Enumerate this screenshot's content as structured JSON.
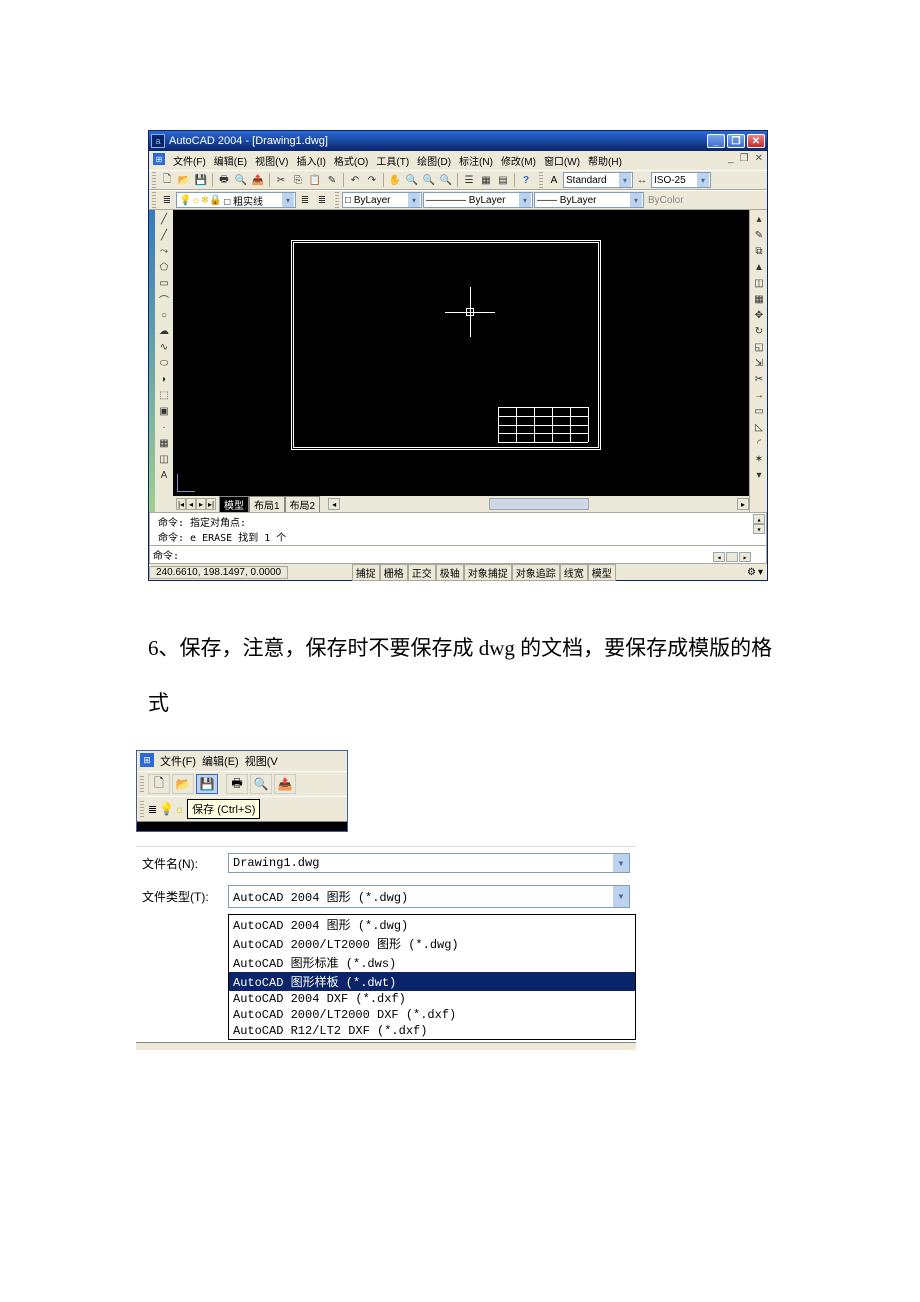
{
  "acad": {
    "title": "AutoCAD 2004 - [Drawing1.dwg]",
    "menu": [
      "文件(F)",
      "编辑(E)",
      "视图(V)",
      "插入(I)",
      "格式(O)",
      "工具(T)",
      "绘图(D)",
      "标注(N)",
      "修改(M)",
      "窗口(W)",
      "帮助(H)"
    ],
    "layerCombo": "□ 粗实线",
    "colorCombo": "□ ByLayer",
    "linetypeCombo": "———— ByLayer",
    "lineweightCombo": "—— ByLayer",
    "bycolorLabel": "ByColor",
    "textStyle": "Standard",
    "dimStyle": "ISO-25",
    "tabs": {
      "model": "模型",
      "layout1": "布局1",
      "layout2": "布局2"
    },
    "cmd": {
      "line1": "命令: 指定对角点:",
      "line2": "命令: e ERASE 找到 1 个",
      "prompt": "命令:"
    },
    "status": {
      "coords": "240.6610, 198.1497, 0.0000",
      "toggles": [
        "捕捉",
        "栅格",
        "正交",
        "极轴",
        "对象捕捉",
        "对象追踪",
        "线宽",
        "模型"
      ]
    }
  },
  "instruction": "6、保存，注意，保存时不要保存成 dwg 的文档，要保存成模版的格式",
  "crop": {
    "menu": [
      "文件(F)",
      "编辑(E)",
      "视图(V"
    ],
    "tooltip": "保存 (Ctrl+S)"
  },
  "savedlg": {
    "filenameLabel": "文件名(N):",
    "filenameValue": "Drawing1.dwg",
    "filetypeLabel": "文件类型(T):",
    "filetypeValue": "AutoCAD 2004 图形 (*.dwg)",
    "options": [
      "AutoCAD 2004 图形 (*.dwg)",
      "AutoCAD 2000/LT2000 图形 (*.dwg)",
      "AutoCAD 图形标准 (*.dws)",
      "AutoCAD 图形样板  (*.dwt)",
      "AutoCAD 2004 DXF (*.dxf)",
      "AutoCAD 2000/LT2000 DXF (*.dxf)",
      "AutoCAD R12/LT2 DXF (*.dxf)"
    ],
    "selectedIndex": 3
  }
}
